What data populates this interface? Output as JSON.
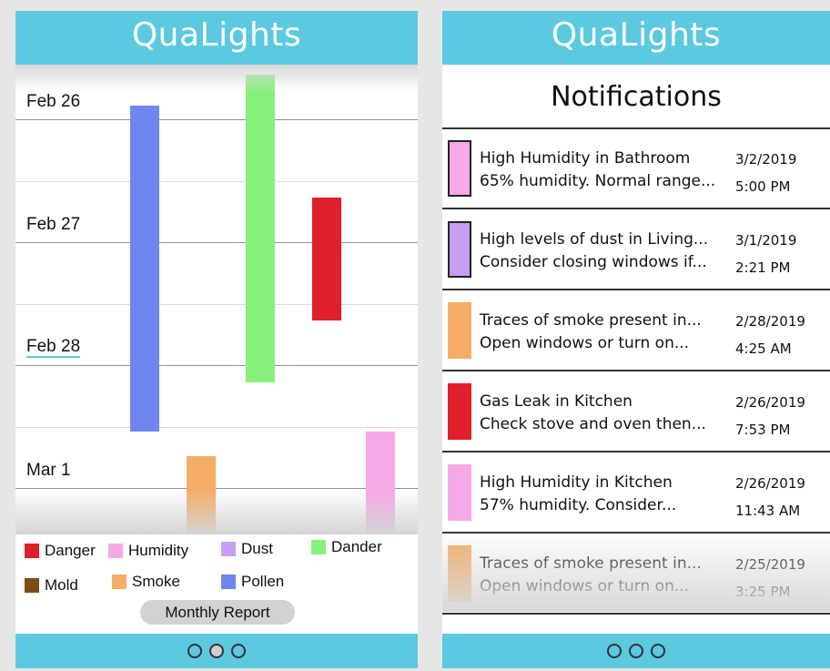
{
  "colors": {
    "header_bg": "#5bc9e0",
    "danger": "#e01f2c",
    "humidity": "#f7a8e6",
    "dust": "#c79ef2",
    "dander": "#86f07a",
    "mold": "#7b4a16",
    "smoke": "#f5ad66",
    "pollen": "#6f86ee"
  },
  "left_screen": {
    "app_title": "QuaLights",
    "chart_data": {
      "type": "timeline",
      "days": [
        "Feb 26",
        "Feb 27",
        "Feb 28",
        "Mar 1"
      ],
      "events": [
        {
          "category": "Pollen",
          "start_day": 0.05,
          "end_day": 2.7
        },
        {
          "category": "Smoke",
          "start_day": 2.9,
          "end_day": 4.0
        },
        {
          "category": "Dander",
          "start_day": -0.2,
          "end_day": 2.3
        },
        {
          "category": "Danger",
          "start_day": 0.8,
          "end_day": 1.8
        },
        {
          "category": "Humidity",
          "start_day": 2.7,
          "end_day": 4.0
        }
      ]
    },
    "legend": [
      {
        "label": "Danger",
        "color": "#e01f2c"
      },
      {
        "label": "Humidity",
        "color": "#f7a8e6"
      },
      {
        "label": "Dust",
        "color": "#c79ef2"
      },
      {
        "label": "Dander",
        "color": "#86f07a"
      },
      {
        "label": "Mold",
        "color": "#7b4a16"
      },
      {
        "label": "Smoke",
        "color": "#f5ad66"
      },
      {
        "label": "Pollen",
        "color": "#6f86ee"
      }
    ],
    "report_button": "Monthly Report",
    "page_dots": 3,
    "active_dot": 1
  },
  "right_screen": {
    "app_title": "QuaLights",
    "section_title": "Notifications",
    "notifications": [
      {
        "title": "High Humidity in Bathroom",
        "body": "65% humidity. Normal range...",
        "date": "3/2/2019",
        "time": "5:00 PM",
        "color": "#f7a8e6",
        "bordered": true
      },
      {
        "title": "High levels of dust in Living...",
        "body": "Consider closing windows if...",
        "date": "3/1/2019",
        "time": "2:21 PM",
        "color": "#c79ef2",
        "bordered": true
      },
      {
        "title": "Traces of smoke present in...",
        "body": "Open windows or turn on...",
        "date": "2/28/2019",
        "time": "4:25 AM",
        "color": "#f5ad66",
        "bordered": false
      },
      {
        "title": "Gas Leak in Kitchen",
        "body": "Check stove and oven then...",
        "date": "2/26/2019",
        "time": "7:53 PM",
        "color": "#e01f2c",
        "bordered": false
      },
      {
        "title": "High Humidity in Kitchen",
        "body": "57% humidity. Consider...",
        "date": "2/26/2019",
        "time": "11:43 AM",
        "color": "#f7a8e6",
        "bordered": false
      },
      {
        "title": "Traces of smoke present in...",
        "body": "Open windows or turn on...",
        "date": "2/25/2019",
        "time": "3:25 PM",
        "color": "#f5ad66",
        "bordered": false
      }
    ],
    "page_dots": 3,
    "active_dot": -1
  }
}
